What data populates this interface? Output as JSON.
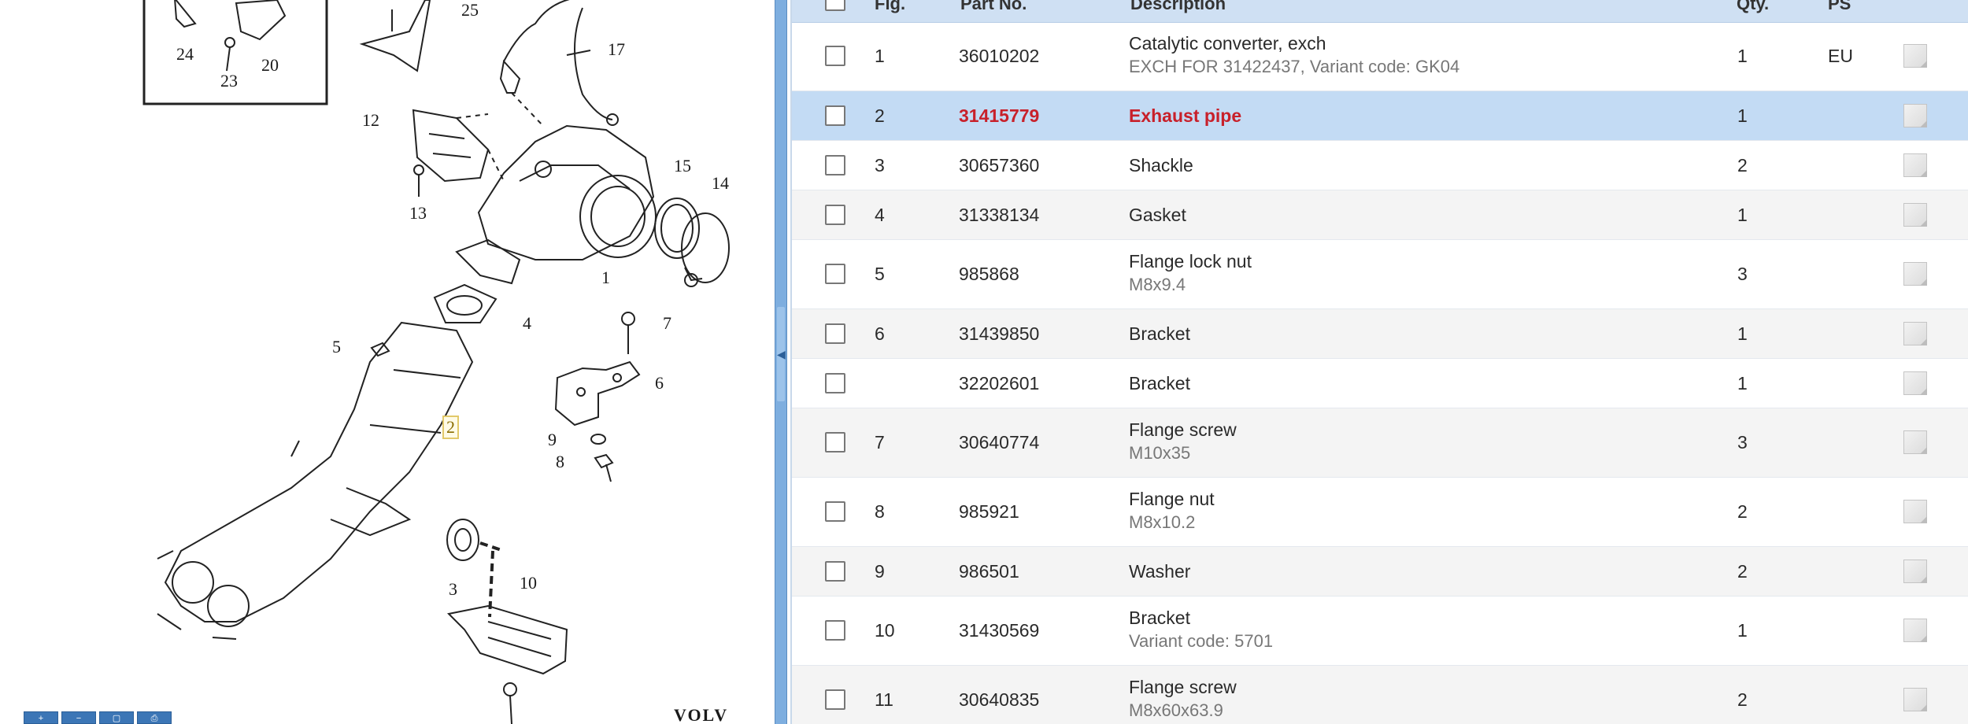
{
  "diagram": {
    "callouts": [
      "24",
      "23",
      "20",
      "25",
      "17",
      "12",
      "13",
      "15",
      "14",
      "1",
      "4",
      "7",
      "5",
      "6",
      "2",
      "9",
      "8",
      "3",
      "10"
    ],
    "highlighted_callout": "2",
    "brand": "VOLV"
  },
  "table": {
    "headers": {
      "fig": "Fig.",
      "part_no": "Part No.",
      "description": "Description",
      "qty": "Qty.",
      "ps": "PS"
    },
    "rows": [
      {
        "fig": "1",
        "part_no": "36010202",
        "desc": "Catalytic converter, exch",
        "sub": "EXCH FOR 31422437, Variant code: GK04",
        "qty": "1",
        "ps": "EU"
      },
      {
        "fig": "2",
        "part_no": "31415779",
        "desc": "Exhaust pipe",
        "sub": "",
        "qty": "1",
        "ps": ""
      },
      {
        "fig": "3",
        "part_no": "30657360",
        "desc": "Shackle",
        "sub": "",
        "qty": "2",
        "ps": ""
      },
      {
        "fig": "4",
        "part_no": "31338134",
        "desc": "Gasket",
        "sub": "",
        "qty": "1",
        "ps": ""
      },
      {
        "fig": "5",
        "part_no": "985868",
        "desc": "Flange lock nut",
        "sub": "M8x9.4",
        "qty": "3",
        "ps": ""
      },
      {
        "fig": "6",
        "part_no": "31439850",
        "desc": "Bracket",
        "sub": "",
        "qty": "1",
        "ps": ""
      },
      {
        "fig": "",
        "part_no": "32202601",
        "desc": "Bracket",
        "sub": "",
        "qty": "1",
        "ps": ""
      },
      {
        "fig": "7",
        "part_no": "30640774",
        "desc": "Flange screw",
        "sub": "M10x35",
        "qty": "3",
        "ps": ""
      },
      {
        "fig": "8",
        "part_no": "985921",
        "desc": "Flange nut",
        "sub": "M8x10.2",
        "qty": "2",
        "ps": ""
      },
      {
        "fig": "9",
        "part_no": "986501",
        "desc": "Washer",
        "sub": "",
        "qty": "2",
        "ps": ""
      },
      {
        "fig": "10",
        "part_no": "31430569",
        "desc": "Bracket",
        "sub": "Variant code: 5701",
        "qty": "1",
        "ps": ""
      },
      {
        "fig": "11",
        "part_no": "30640835",
        "desc": "Flange screw",
        "sub": "M8x60x63.9",
        "qty": "2",
        "ps": ""
      }
    ]
  },
  "colors": {
    "header_bg": "#cfe0f3",
    "selected_row_bg": "#c3dbf4",
    "selected_text": "#c8202a",
    "splitter": "#7eaedf"
  }
}
